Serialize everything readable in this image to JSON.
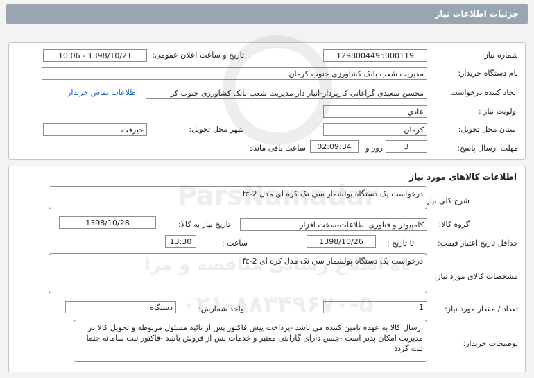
{
  "header": {
    "title": "جزئیات اطلاعات نیاز"
  },
  "info": {
    "need_number_label": "شماره نیاز:",
    "need_number": "1298004495000119",
    "announce_label": "تاریخ و ساعت اعلان عمومی:",
    "announce_value": "1398/10/21 - 10:06",
    "buyer_label": "نام دستگاه خریدار:",
    "buyer_value": "مدیریت شعب بانک کشاورزی جنوب کرمان",
    "creator_label": "ایجاد کننده درخواست:",
    "creator_value": "محسن سعیدی گراغانی کارپرداز-انبار دار مدیریت شعب بانک کشاورزی جنوب کر",
    "contact_link": "اطلاعات تماس خریدار",
    "priority_label": "اولویت نیاز :",
    "priority_value": "عادي",
    "province_label": "استان محل تحویل:",
    "province_value": "کرمان",
    "city_label": "شهر محل تحویل:",
    "city_value": "جیرفت",
    "deadline_label": "مهلت ارسال پاسخ:",
    "days_value": "3",
    "days_and": "روز و",
    "time_value": "02:09:34",
    "remaining": "ساعت باقی مانده"
  },
  "goods": {
    "section_title": "اطلاعات کالاهای مورد نیاز",
    "summary_label": "شرح کلی نیاز:",
    "summary_value": "درخواست یک دستگاه پولشمار سی تک کره ای  مدل fc-2",
    "group_label": "گروه کالا:",
    "group_value": "کامپیوتر و فناوری اطلاعات-سخت افزار",
    "need_date_label": "تاریخ نیاز به کالا:",
    "need_date_value": "1398/10/28",
    "validity_label": "حداقل تاریخ اعتبار قیمت:",
    "until_date_label": "تا تاریخ :",
    "until_date_value": "1398/10/26",
    "hour_label": "ساعت :",
    "hour_value": "13:30",
    "specs_label": "مشخصات کالای مورد نیاز:",
    "specs_value": "درخواست یک دستگاه پولشمار سی تک مدل  کره ای fc-2",
    "qty_label": "تعداد / مقدار مورد نیاز:",
    "qty_value": "1",
    "unit_label": "واحد شمارش:",
    "unit_value": "دستگاه",
    "buyer_notes_label": "توضیحات خریدار:",
    "buyer_notes_value": "ارسال کالا به عهده تامین کننده می باشد -پرداخت پیش فاکتور پس از تائید مسئول مربوطه و تحویل کالا در مدیریت امکان پذیر است -جنس دارای گارانتی معتبر و خدمات پس از فروش باشد -فاکتور ثبت سامانه حتما ثبت گردد"
  },
  "watermark": {
    "brand": "ParsNamadar",
    "line1": "پایگاه اطلاع رسانی مناقصه و مزایده",
    "phone": "۰۲۱-۸۸۳۴۹۶۷۰-۵"
  }
}
